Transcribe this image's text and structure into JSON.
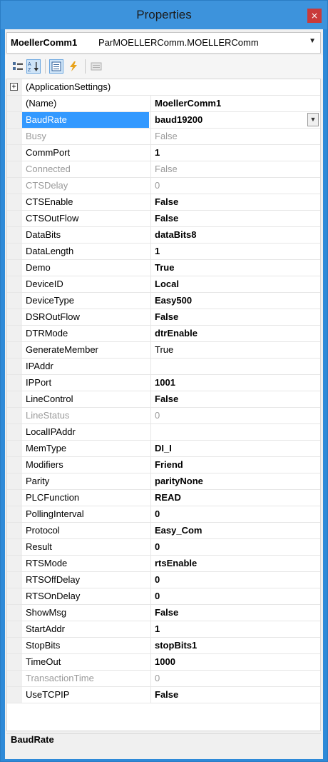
{
  "window": {
    "title": "Properties",
    "close_glyph": "×"
  },
  "object_selector": {
    "name": "MoellerComm1",
    "type": "ParMOELLERComm.MOELLERComm"
  },
  "toolbar": {
    "buttons": [
      {
        "icon": "categorized-icon"
      },
      {
        "icon": "alphabetical-icon",
        "active": true
      },
      {
        "icon": "properties-icon",
        "active": true
      },
      {
        "icon": "events-icon"
      },
      {
        "icon": "property-pages-icon"
      }
    ]
  },
  "grid": {
    "group": {
      "label": "(ApplicationSettings)",
      "expander": "+"
    },
    "rows": [
      {
        "name": "(Name)",
        "value": "MoellerComm1",
        "bold": true
      },
      {
        "name": "BaudRate",
        "value": "baud19200",
        "bold": true,
        "selected": true
      },
      {
        "name": "Busy",
        "value": "False",
        "readonly": true
      },
      {
        "name": "CommPort",
        "value": "1",
        "bold": true
      },
      {
        "name": "Connected",
        "value": "False",
        "readonly": true
      },
      {
        "name": "CTSDelay",
        "value": "0",
        "readonly": true
      },
      {
        "name": "CTSEnable",
        "value": "False",
        "bold": true
      },
      {
        "name": "CTSOutFlow",
        "value": "False",
        "bold": true
      },
      {
        "name": "DataBits",
        "value": "dataBits8",
        "bold": true
      },
      {
        "name": "DataLength",
        "value": "1",
        "bold": true
      },
      {
        "name": "Demo",
        "value": "True",
        "bold": true
      },
      {
        "name": "DeviceID",
        "value": "Local",
        "bold": true
      },
      {
        "name": "DeviceType",
        "value": "Easy500",
        "bold": true
      },
      {
        "name": "DSROutFlow",
        "value": "False",
        "bold": true
      },
      {
        "name": "DTRMode",
        "value": "dtrEnable",
        "bold": true
      },
      {
        "name": "GenerateMember",
        "value": "True"
      },
      {
        "name": "IPAddr",
        "value": ""
      },
      {
        "name": "IPPort",
        "value": "1001",
        "bold": true
      },
      {
        "name": "LineControl",
        "value": "False",
        "bold": true
      },
      {
        "name": "LineStatus",
        "value": "0",
        "readonly": true
      },
      {
        "name": "LocalIPAddr",
        "value": ""
      },
      {
        "name": "MemType",
        "value": "DI_I",
        "bold": true
      },
      {
        "name": "Modifiers",
        "value": "Friend",
        "bold": true
      },
      {
        "name": "Parity",
        "value": "parityNone",
        "bold": true
      },
      {
        "name": "PLCFunction",
        "value": "READ",
        "bold": true
      },
      {
        "name": "PollingInterval",
        "value": "0",
        "bold": true
      },
      {
        "name": "Protocol",
        "value": "Easy_Com",
        "bold": true
      },
      {
        "name": "Result",
        "value": "0",
        "bold": true
      },
      {
        "name": "RTSMode",
        "value": "rtsEnable",
        "bold": true
      },
      {
        "name": "RTSOffDelay",
        "value": "0",
        "bold": true
      },
      {
        "name": "RTSOnDelay",
        "value": "0",
        "bold": true
      },
      {
        "name": "ShowMsg",
        "value": "False",
        "bold": true
      },
      {
        "name": "StartAddr",
        "value": "1",
        "bold": true
      },
      {
        "name": "StopBits",
        "value": "stopBits1",
        "bold": true
      },
      {
        "name": "TimeOut",
        "value": "1000",
        "bold": true
      },
      {
        "name": "TransactionTime",
        "value": "0",
        "readonly": true
      },
      {
        "name": "UseTCPIP",
        "value": "False",
        "bold": true
      }
    ]
  },
  "description": {
    "title": "BaudRate"
  },
  "colors": {
    "titlebar": "#3d93dc",
    "selection": "#3399ff",
    "close": "#c93a3a"
  }
}
